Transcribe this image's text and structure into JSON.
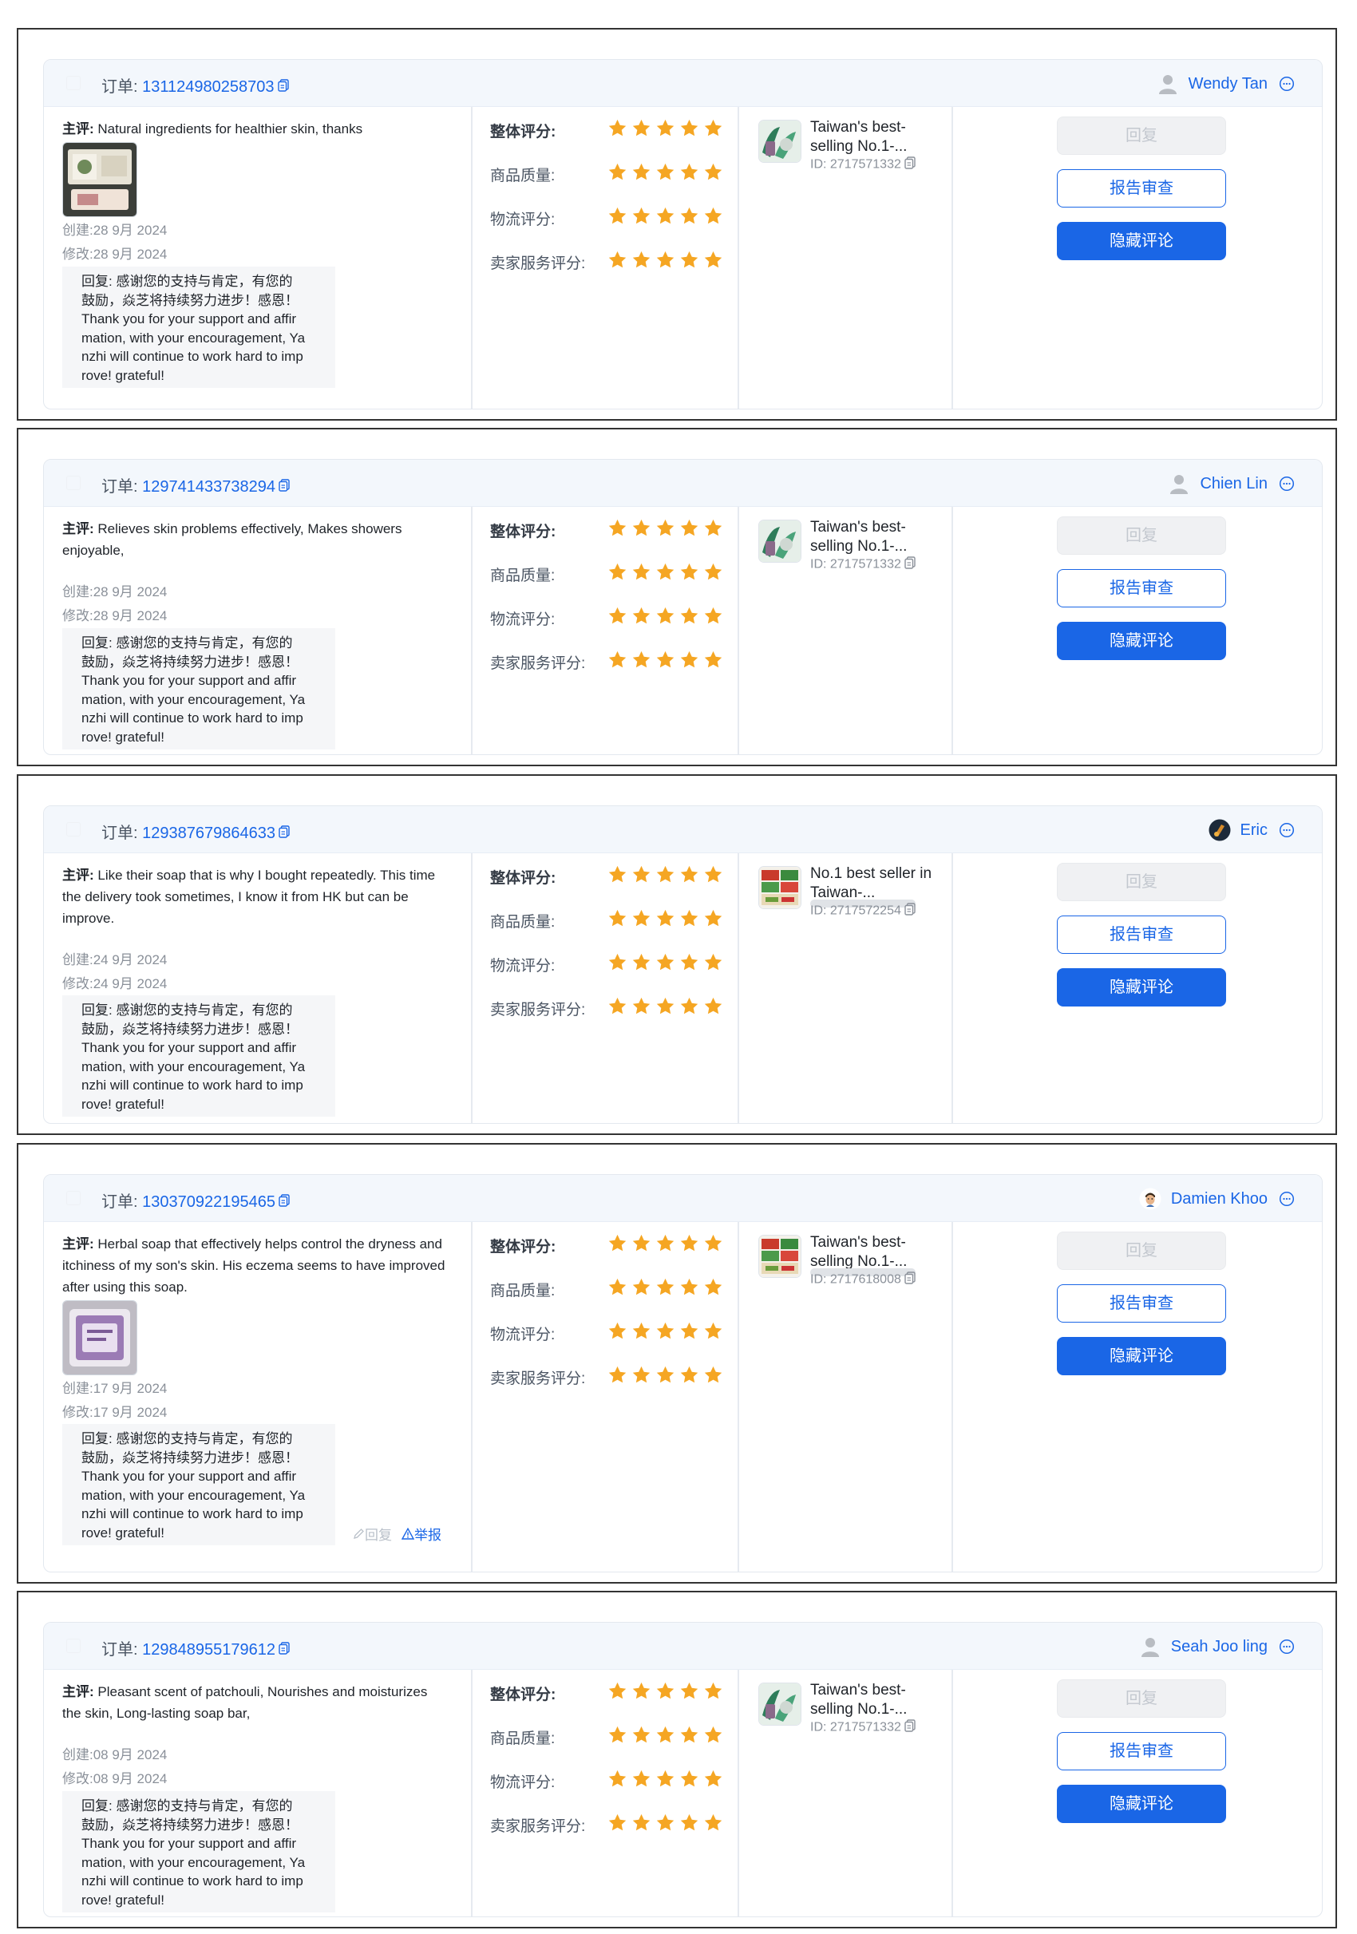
{
  "labels": {
    "order_prefix": "订单: ",
    "review_prefix": "主评: ",
    "overall": "整体评分:",
    "quality": "商品质量:",
    "logistics": "物流评分:",
    "seller_service": "卖家服务评分:",
    "reply_button": "回复",
    "audit_button": "报告审查",
    "hide_button": "隐藏评论",
    "inline_reply": "回复",
    "inline_report": "举报"
  },
  "colors": {
    "accent": "#1a66e6",
    "star": "#f5a623",
    "disabled_text": "#c3c8cf"
  },
  "reply_lines": [
    "回复: 感谢您的支持与肯定，有您的",
    "鼓励，焱芝将持续努力进步！感恩！",
    "Thank you for your support and affir",
    "mation, with your encouragement, Ya",
    "nzhi will continue to work hard to imp",
    "rove! grateful!"
  ],
  "reviews": [
    {
      "order_no": "131124980258703",
      "user": "Wendy Tan",
      "avatar": "default-person-avatar",
      "review_lines": [
        "Natural ingredients for healthier skin, thanks"
      ],
      "has_image": true,
      "image_kind": "soap-package-photo",
      "created": "创建:28 9月 2024",
      "modified": "修改:28 9月 2024",
      "ratings": {
        "overall": 5,
        "quality": 5,
        "logistics": 5,
        "seller_service": 5
      },
      "product_title": "Taiwan's best-selling No.1-...",
      "product_id": "ID: 2717571332",
      "product_img": "green-herb-product"
    },
    {
      "order_no": "129741433738294",
      "user": "Chien Lin",
      "avatar": "default-person-avatar",
      "review_lines": [
        "Relieves skin problems effectively, Makes showers",
        "enjoyable,"
      ],
      "has_image": false,
      "created": "创建:28 9月 2024",
      "modified": "修改:28 9月 2024",
      "ratings": {
        "overall": 5,
        "quality": 5,
        "logistics": 5,
        "seller_service": 5
      },
      "product_title": "Taiwan's best-selling No.1-...",
      "product_id": "ID: 2717571332",
      "product_img": "green-herb-product"
    },
    {
      "order_no": "129387679864633",
      "user": "Eric",
      "avatar": "photo-avatar",
      "review_lines": [
        "Like their soap that is why I bought repeatedly. This time",
        "the delivery took sometimes, I know it from HK but can be",
        "improve."
      ],
      "has_image": false,
      "created": "创建:24 9月 2024",
      "modified": "修改:24 9月 2024",
      "ratings": {
        "overall": 5,
        "quality": 5,
        "logistics": 5,
        "seller_service": 5
      },
      "product_title": "No.1 best seller in Taiwan-...",
      "product_id": "ID: 2717572254",
      "product_img": "red-green-bundle-product"
    },
    {
      "order_no": "130370922195465",
      "user": "Damien Khoo",
      "avatar": "cartoon-avatar",
      "review_lines": [
        "Herbal soap that effectively helps control the dryness and",
        "itchiness of my son's skin. His eczema seems to have improved",
        "after using this soap."
      ],
      "has_image": true,
      "image_kind": "purple-soap-bar-photo",
      "created": "创建:17 9月 2024",
      "modified": "修改:17 9月 2024",
      "ratings": {
        "overall": 5,
        "quality": 5,
        "logistics": 5,
        "seller_service": 5
      },
      "product_title": "Taiwan's best-selling No.1-...",
      "product_id": "ID: 2717618008",
      "product_img": "red-green-bundle-product"
    },
    {
      "order_no": "129848955179612",
      "user": "Seah Joo ling",
      "avatar": "default-person-avatar",
      "review_lines": [
        "Pleasant scent of patchouli, Nourishes and moisturizes",
        "the skin, Long-lasting soap bar,"
      ],
      "has_image": false,
      "created": "创建:08 9月 2024",
      "modified": "修改:08 9月 2024",
      "ratings": {
        "overall": 5,
        "quality": 5,
        "logistics": 5,
        "seller_service": 5
      },
      "product_title": "Taiwan's best-selling No.1-...",
      "product_id": "ID: 2717571332",
      "product_img": "green-herb-product"
    }
  ]
}
